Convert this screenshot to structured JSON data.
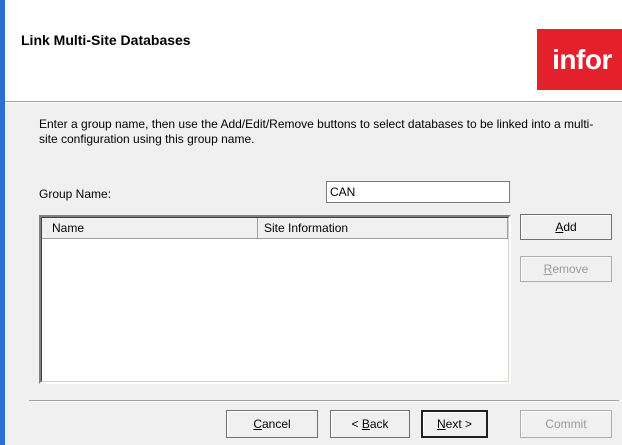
{
  "dialog": {
    "title": "Link Multi-Site Databases",
    "logo_text": "infor",
    "instructions": "Enter a group name, then use the Add/Edit/Remove buttons to select databases to be linked into a multi-site configuration using this group name."
  },
  "form": {
    "group_name_label": "Group Name:",
    "group_name_value": "CAN"
  },
  "table": {
    "columns": [
      "Name",
      "Site Information"
    ],
    "rows": []
  },
  "side_buttons": {
    "add": {
      "mnemonic": "A",
      "rest": "dd"
    },
    "remove": {
      "mnemonic": "R",
      "rest": "emove"
    }
  },
  "footer_buttons": {
    "cancel": {
      "mnemonic": "C",
      "rest": "ancel"
    },
    "back": {
      "prefix": "< ",
      "mnemonic": "B",
      "rest": "ack"
    },
    "next": {
      "mnemonic": "N",
      "rest": "ext >"
    },
    "commit": "Commit"
  },
  "colors": {
    "logo_red": "#e3202c",
    "window_edge": "#2a6fd1"
  }
}
